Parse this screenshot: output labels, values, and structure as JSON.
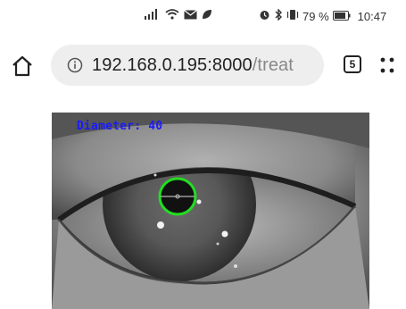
{
  "status_bar": {
    "battery_percent": "79 %",
    "time": "10:47",
    "icons": [
      "signal-icon",
      "wifi-icon",
      "mail-icon",
      "leaf-icon",
      "alarm-icon",
      "bluetooth-icon",
      "vibrate-icon",
      "battery-icon"
    ]
  },
  "browser": {
    "url_host": "192.168.0.195:8000",
    "url_path": "/treat",
    "tab_count": "5"
  },
  "camera": {
    "overlay_text": "Diameter: 40",
    "overlay_color": "#1a1aff",
    "pupil_ring_color": "#22dd22"
  }
}
